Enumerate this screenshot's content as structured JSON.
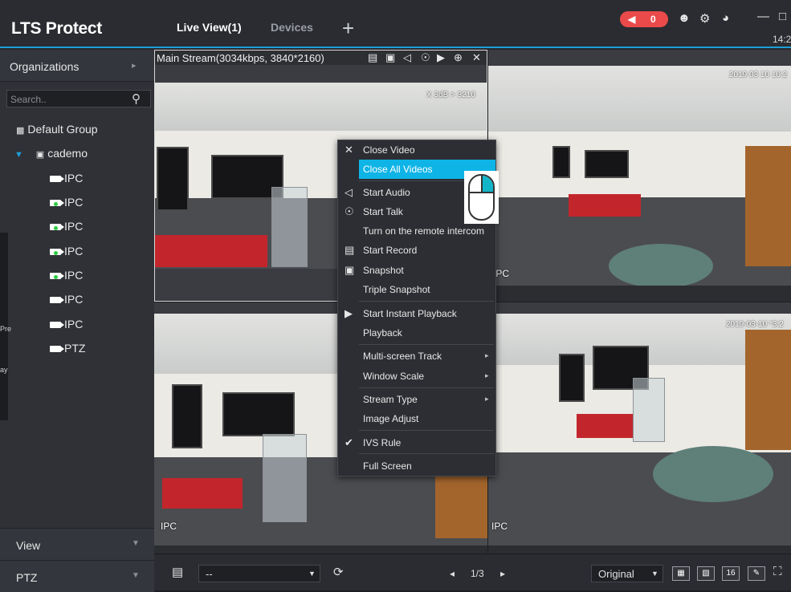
{
  "header": {
    "logo": "LTS Protect",
    "tabs": [
      {
        "label": "Live View(1)"
      },
      {
        "label": "Devices"
      }
    ],
    "add_tab": "+",
    "alarm_count": "0",
    "clock": "14:2"
  },
  "sidebar": {
    "section_title": "Organizations",
    "search_placeholder": "Search..",
    "tree": {
      "root": "Default Group",
      "device": "cademo",
      "channels": [
        {
          "label": "IPC",
          "online": false
        },
        {
          "label": "IPC",
          "online": true
        },
        {
          "label": "IPC",
          "online": true
        },
        {
          "label": "IPC",
          "online": true
        },
        {
          "label": "IPC",
          "online": true
        },
        {
          "label": "IPC",
          "online": false
        },
        {
          "label": "IPC",
          "online": false
        },
        {
          "label": "PTZ",
          "online": false
        }
      ]
    },
    "bottom_sections": [
      {
        "label": "View"
      },
      {
        "label": "PTZ"
      }
    ],
    "strip_fragments": [
      "Pre",
      "ay"
    ]
  },
  "video": {
    "stream_info": "Main Stream(3034kbps, 3840*2160)",
    "tiles": [
      {
        "label": "",
        "osd": "",
        "osd_small": "X 3dB > 3210"
      },
      {
        "label": "IPC",
        "osd": "2019 03 10 10:2",
        "osd_small": ""
      },
      {
        "label": "IPC",
        "osd": "",
        "osd_small": ""
      },
      {
        "label": "IPC",
        "osd": "2019-03-10 *3:2",
        "osd_small": ""
      }
    ]
  },
  "context_menu": {
    "items": [
      {
        "label": "Close Video",
        "icon": "close-icon",
        "highlighted": false,
        "checked": false,
        "submenu": false
      },
      {
        "label": "Close All Videos",
        "icon": "",
        "highlighted": true,
        "checked": false,
        "submenu": false
      },
      {
        "label": "Start Audio",
        "icon": "speaker-icon",
        "highlighted": false,
        "checked": false,
        "submenu": false
      },
      {
        "label": "Start Talk",
        "icon": "microphone-icon",
        "highlighted": false,
        "checked": false,
        "submenu": false
      },
      {
        "label": "Turn on the remote intercom",
        "icon": "",
        "highlighted": false,
        "checked": false,
        "submenu": false
      },
      {
        "label": "Start Record",
        "icon": "record-icon",
        "highlighted": false,
        "checked": false,
        "submenu": false
      },
      {
        "label": "Snapshot",
        "icon": "camera-icon",
        "highlighted": false,
        "checked": false,
        "submenu": false
      },
      {
        "label": "Triple Snapshot",
        "icon": "",
        "highlighted": false,
        "checked": false,
        "submenu": false
      },
      {
        "label": "Start Instant Playback",
        "icon": "play-icon",
        "highlighted": false,
        "checked": false,
        "submenu": false
      },
      {
        "label": "Playback",
        "icon": "",
        "highlighted": false,
        "checked": false,
        "submenu": false
      },
      {
        "label": "Multi-screen Track",
        "icon": "",
        "highlighted": false,
        "checked": false,
        "submenu": true
      },
      {
        "label": "Window Scale",
        "icon": "",
        "highlighted": false,
        "checked": false,
        "submenu": true
      },
      {
        "label": "Stream Type",
        "icon": "",
        "highlighted": false,
        "checked": false,
        "submenu": true
      },
      {
        "label": "Image Adjust",
        "icon": "",
        "highlighted": false,
        "checked": false,
        "submenu": false
      },
      {
        "label": "IVS Rule",
        "icon": "",
        "highlighted": false,
        "checked": true,
        "submenu": false
      },
      {
        "label": "Full Screen",
        "icon": "",
        "highlighted": false,
        "checked": false,
        "submenu": false
      }
    ]
  },
  "toolbar": {
    "view_select": "--",
    "page": "1/3",
    "scale_select": "Original",
    "layout_16": "16"
  },
  "colors": {
    "accent": "#1c9fd8",
    "highlight": "#0fb4e6",
    "alarm": "#ea4a4a",
    "online": "#2ecc40"
  }
}
